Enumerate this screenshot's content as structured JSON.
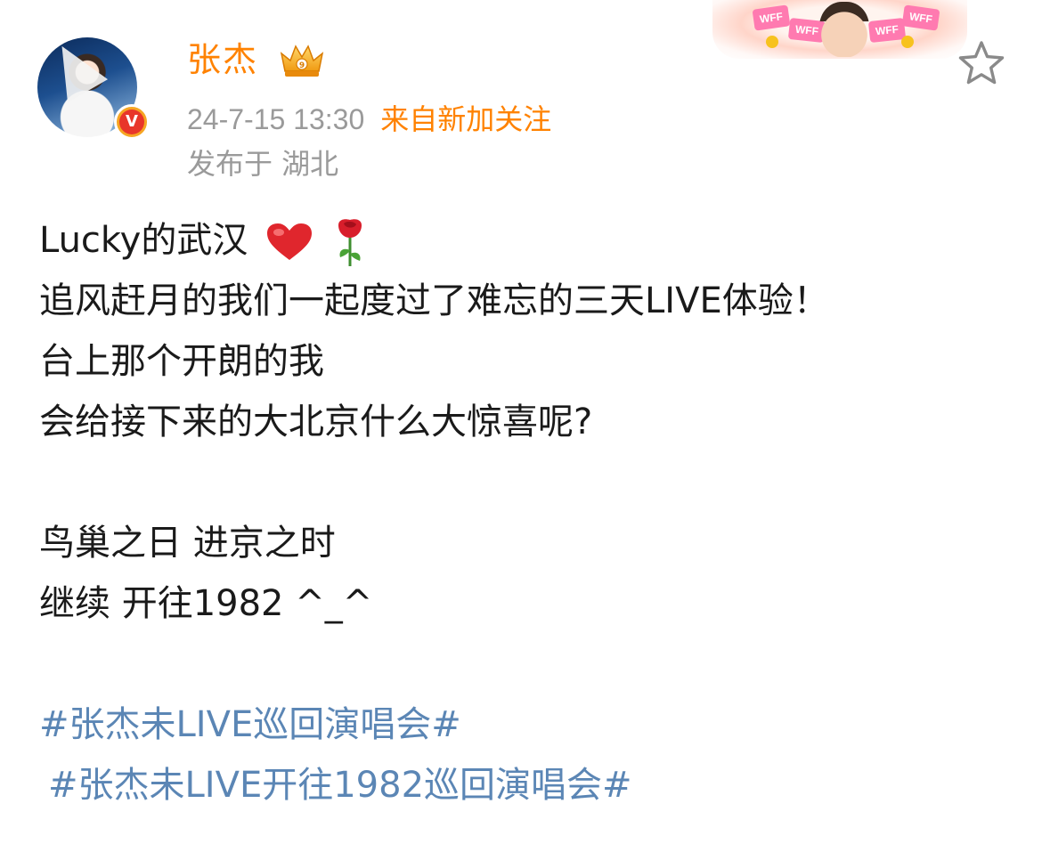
{
  "header": {
    "username": "张杰",
    "timestamp": "24-7-15 13:30",
    "source": "来自新加关注",
    "location": "发布于 湖北",
    "verified_icon": "verified-v-icon",
    "badge_icon": "crown-badge-icon",
    "banner_sticker_1": "WFF",
    "banner_sticker_2": "WFF",
    "banner_sticker_3": "WFF",
    "banner_sticker_4": "WFF",
    "favorite_icon": "star-outline-icon"
  },
  "post": {
    "line1_text": "Lucky的武汉",
    "line1_emojis": [
      "red-heart-emoji",
      "rose-emoji"
    ],
    "line2": "追风赶月的我们一起度过了难忘的三天LIVE体验！",
    "line3": "台上那个开朗的我",
    "line4": "会给接下来的大北京什么大惊喜呢?",
    "line5": "鸟巢之日 进京之时",
    "line6": "继续 开往1982 ^_^",
    "hashtags": [
      "#张杰未LIVE巡回演唱会#",
      "#张杰未LIVE开往1982巡回演唱会#"
    ]
  },
  "colors": {
    "username": "#ff8200",
    "source": "#ff8200",
    "meta": "#9a9a9a",
    "hashtag": "#5b86b5",
    "text": "#1a1a1a"
  }
}
